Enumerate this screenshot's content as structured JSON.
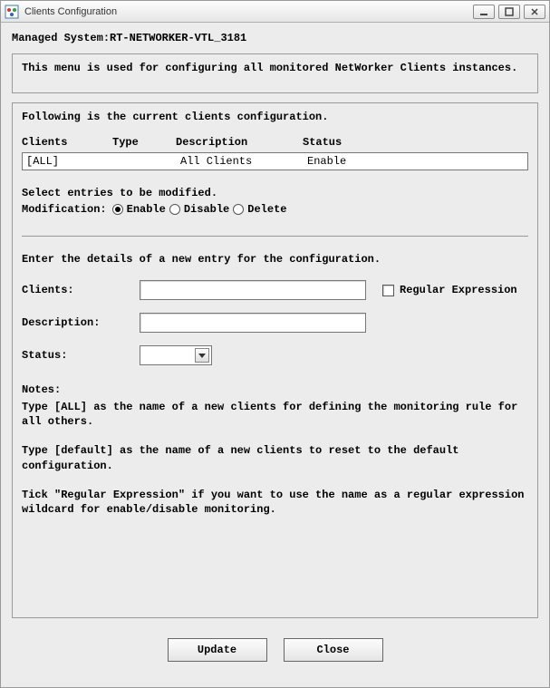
{
  "window": {
    "title": "Clients Configuration"
  },
  "header": {
    "managed_label": "Managed System:",
    "managed_value": "RT-NETWORKER-VTL_3181"
  },
  "info_text": "This menu is used for configuring all monitored NetWorker Clients instances.",
  "config": {
    "intro": "Following is the current clients configuration.",
    "columns": {
      "clients": "Clients",
      "type": "Type",
      "description": "Description",
      "status": "Status"
    },
    "rows": [
      {
        "clients": "[ALL]",
        "type": "",
        "description": "All Clients",
        "status": "Enable"
      }
    ],
    "select_instr": "Select entries to be modified.",
    "mod_label": "Modification:",
    "mod_options": {
      "enable": "Enable",
      "disable": "Disable",
      "delete": "Delete"
    },
    "mod_selected": "enable"
  },
  "new_entry": {
    "intro": "Enter the details of a new entry for the configuration.",
    "clients_label": "Clients:",
    "clients_value": "",
    "regex_label": "Regular Expression",
    "regex_checked": false,
    "description_label": "Description:",
    "description_value": "",
    "status_label": "Status:",
    "status_value": ""
  },
  "notes": {
    "heading": "Notes:",
    "n1": "Type [ALL] as the name of a new clients for defining the monitoring rule for all others.",
    "n2": "Type [default] as the name of a new clients to reset to the default configuration.",
    "n3": "Tick \"Regular Expression\" if you want to use the name as a regular expression wildcard for enable/disable monitoring."
  },
  "buttons": {
    "update": "Update",
    "close": "Close"
  }
}
